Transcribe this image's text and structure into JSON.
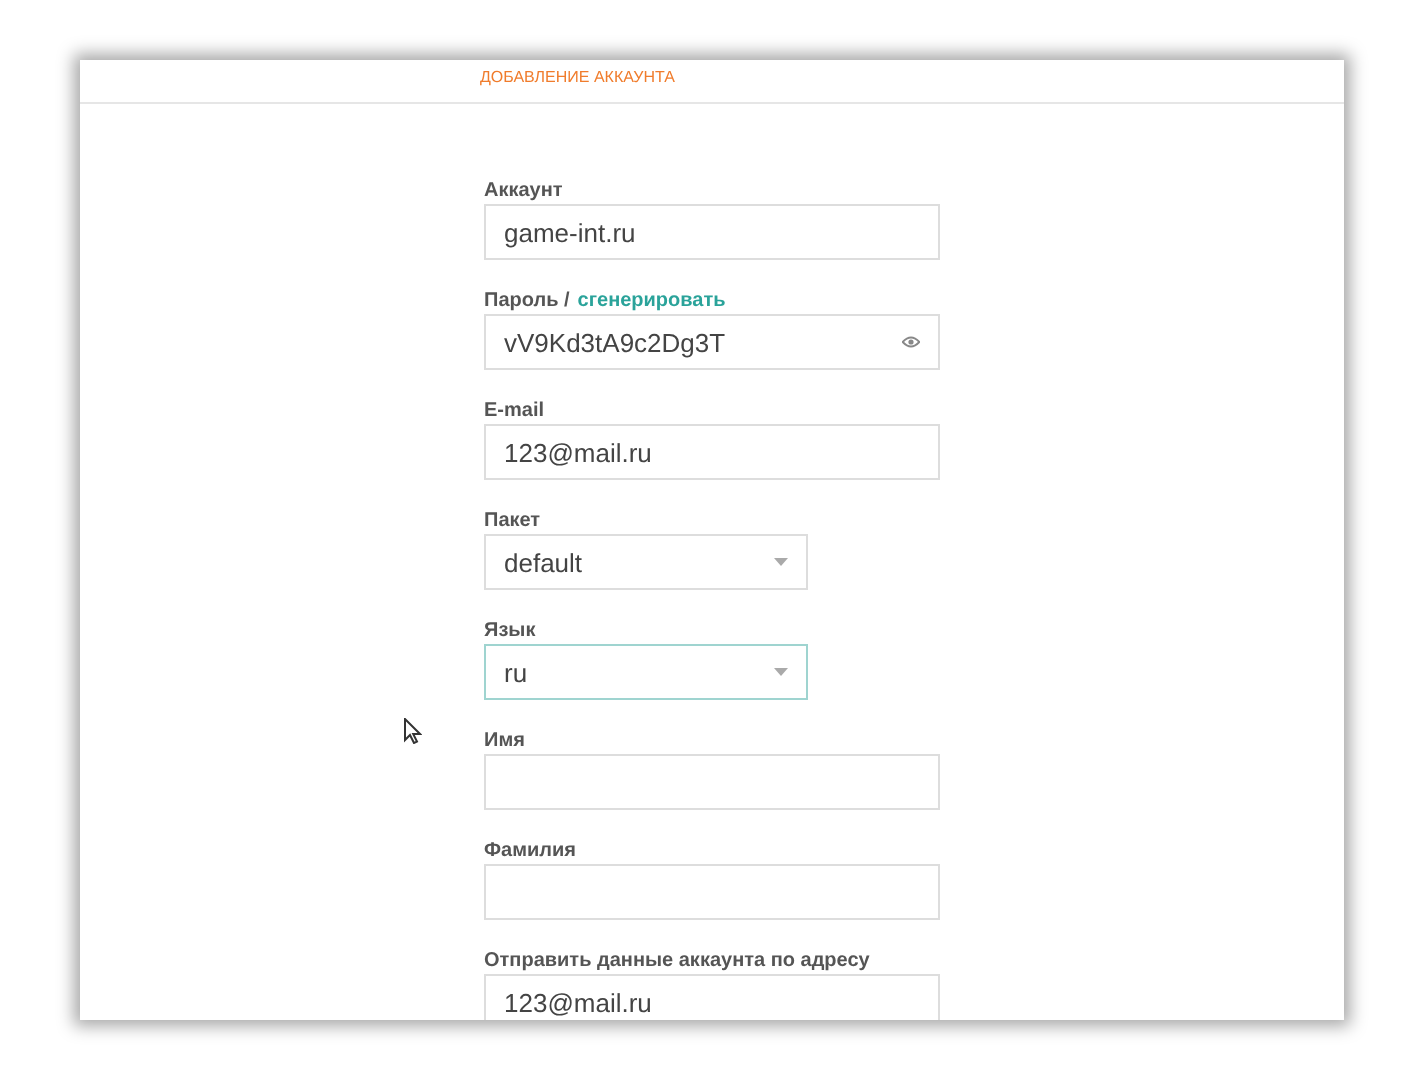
{
  "header": {
    "title": "ДОБАВЛЕНИЕ АККАУНТА"
  },
  "fields": [
    {
      "kind": "text",
      "label": "Аккаунт",
      "value": "game-int.ru",
      "focused": false
    },
    {
      "kind": "password",
      "label": "Пароль /",
      "label_link": "сгенерировать",
      "value": "vV9Kd3tA9c2Dg3T",
      "focused": false
    },
    {
      "kind": "text",
      "label": "E-mail",
      "value": "123@mail.ru",
      "focused": false
    },
    {
      "kind": "select",
      "label": "Пакет",
      "value": "default",
      "focused": false
    },
    {
      "kind": "select",
      "label": "Язык",
      "value": "ru",
      "focused": true
    },
    {
      "kind": "text",
      "label": "Имя",
      "focused": false
    },
    {
      "kind": "text",
      "label": "Фамилия",
      "focused": false
    },
    {
      "kind": "text",
      "label": "Отправить данные аккаунта по адресу",
      "value": "123@mail.ru",
      "focused": false
    }
  ]
}
